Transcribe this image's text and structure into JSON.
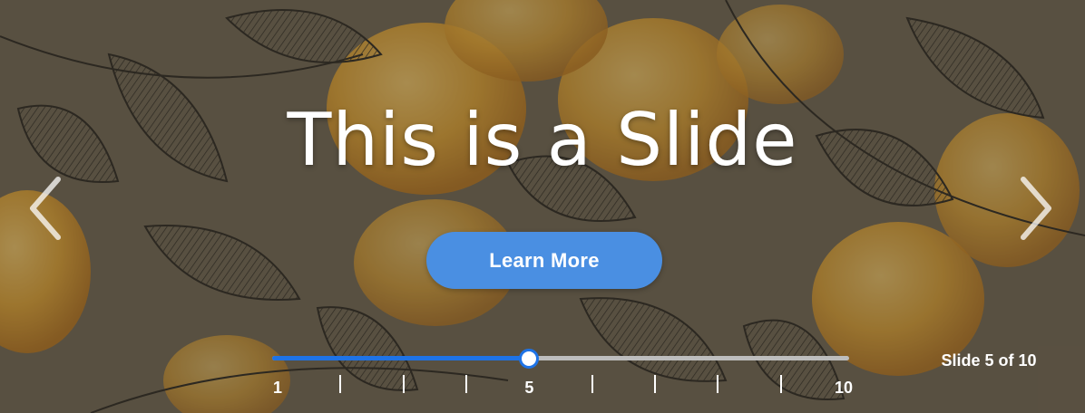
{
  "slide": {
    "title": "This is a Slide",
    "cta_label": "Learn More",
    "counter_text": "Slide 5 of 10",
    "prev_icon": "chevron-left-icon",
    "next_icon": "chevron-right-icon"
  },
  "slider": {
    "min": 1,
    "max": 10,
    "value": 5,
    "labels": [
      "1",
      "5",
      "10"
    ]
  },
  "colors": {
    "accent": "#1e73e6",
    "button": "#4a8fe2",
    "track": "#bdbdbd",
    "text": "#ffffff"
  }
}
